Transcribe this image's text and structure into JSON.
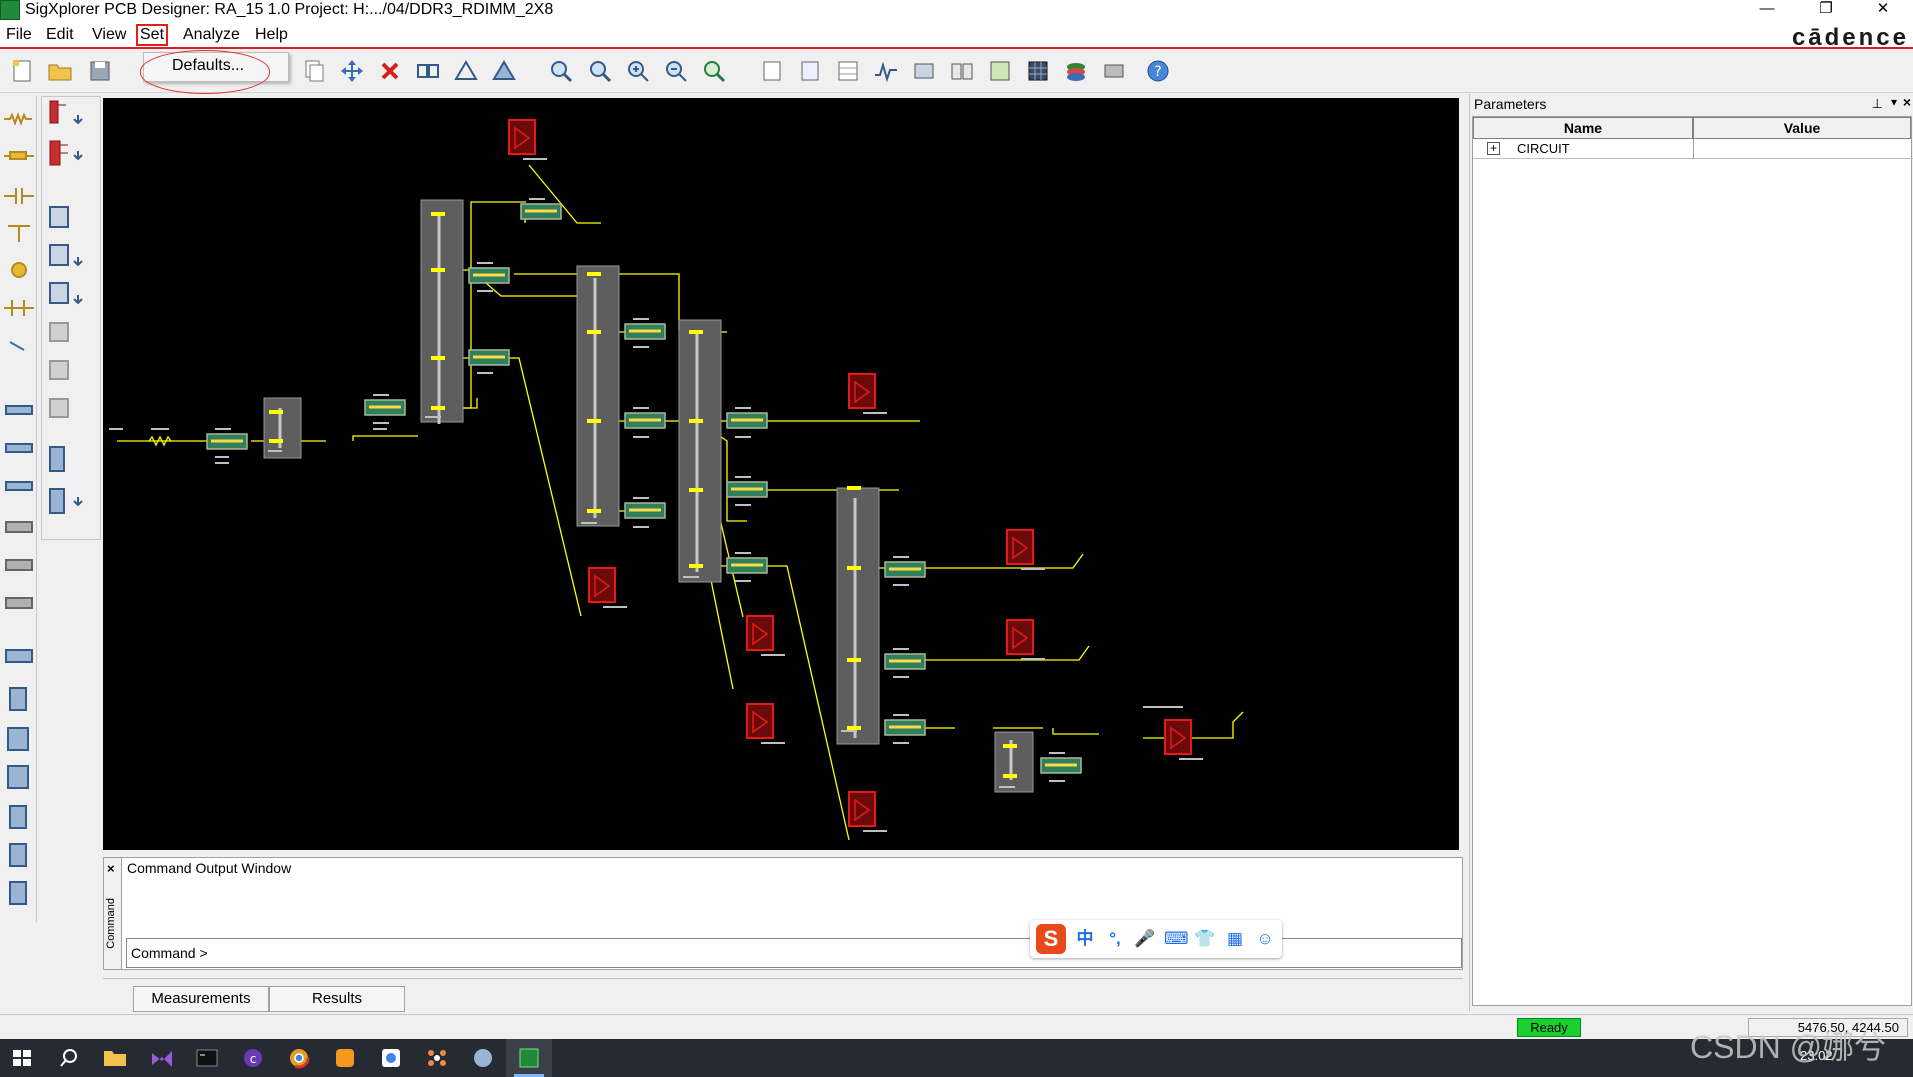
{
  "window": {
    "title": "SigXplorer PCB Designer: RA_15 1.0  Project: H:.../04/DDR3_RDIMM_2X8",
    "minimize": "—",
    "restore": "❐",
    "close": "✕"
  },
  "menu": {
    "file": "File",
    "edit": "Edit",
    "view": "View",
    "set": "Set",
    "analyze": "Analyze",
    "help": "Help",
    "brand": "cādence"
  },
  "dropdown": {
    "defaults": "Defaults..."
  },
  "parameters": {
    "title": "Parameters",
    "pin": "⊥",
    "arrow": "▾",
    "close": "×",
    "col_name": "Name",
    "col_value": "Value",
    "expand": "+",
    "rows": [
      {
        "name": "CIRCUIT",
        "value": ""
      }
    ]
  },
  "command": {
    "close": "×",
    "side_label": "Command",
    "title": "Command Output Window",
    "prompt": "Command >"
  },
  "ime": [
    "中",
    "°,",
    "🎤",
    "⌨",
    "👕",
    "▦",
    "☺"
  ],
  "tabs": {
    "measurements": "Measurements",
    "results": "Results"
  },
  "status": {
    "ready": "Ready",
    "coords": "5476.50, 4244.50"
  },
  "taskbar": {
    "time": "23:02",
    "watermark": "CSDN @娜兮"
  },
  "colors": {
    "canvas_bg": "#000000",
    "wire": "#ffff00",
    "tline_fill": "#2a7a5a",
    "ic_fill": "#666666",
    "receiver": "#e01010",
    "ready": "#18d02e"
  }
}
